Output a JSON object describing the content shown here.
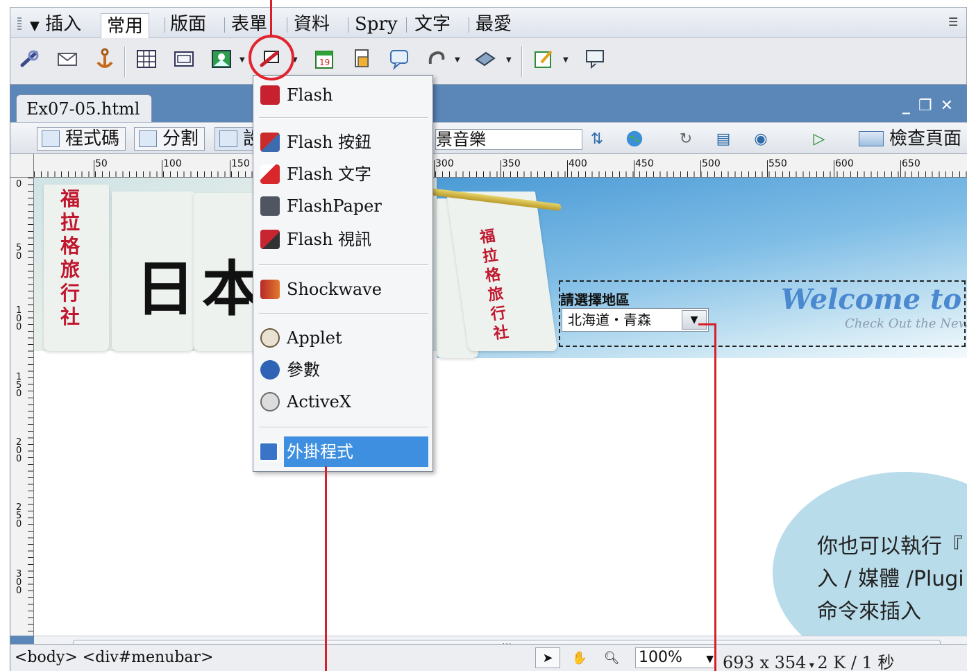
{
  "insert_panel": {
    "menu_label": "插入",
    "tabs": [
      {
        "label": "常用",
        "active": true
      },
      {
        "label": "版面",
        "active": false
      },
      {
        "label": "表單",
        "active": false
      },
      {
        "label": "資料",
        "active": false
      },
      {
        "label": "Spry",
        "active": false
      },
      {
        "label": "文字",
        "active": false
      },
      {
        "label": "最愛",
        "active": false
      }
    ],
    "icons": [
      "hyperlink-icon",
      "email-link-icon",
      "named-anchor-icon",
      "table-icon",
      "layer-icon",
      "image-icon",
      "media-icon",
      "date-icon",
      "server-side-include-icon",
      "comment-icon",
      "head-icon",
      "script-icon",
      "templates-icon",
      "tag-chooser-icon"
    ]
  },
  "document": {
    "file_tab": "Ex07-05.html",
    "view_buttons": {
      "code": "程式碼",
      "split": "分割",
      "design": "設"
    },
    "title_value": "景音樂",
    "check_page": "檢查頁面"
  },
  "ruler": {
    "h_labels": [
      "50",
      "100",
      "150",
      "300",
      "350",
      "400",
      "450",
      "500",
      "550",
      "600",
      "650"
    ],
    "v_labels": [
      "0",
      "50",
      "100",
      "150",
      "200",
      "250",
      "300"
    ]
  },
  "page": {
    "banner_big_text": "日本",
    "banner_side_text_left": "福拉格旅行社",
    "banner_side_text_right": "福拉格旅行社",
    "region_label": "請選擇地區",
    "region_selected": "北海道・青森",
    "welcome": "Welcome to Ja",
    "welcome_sub": "Check Out the New",
    "callout": "你也可以執行『\n入 / 媒體 /Plugi\n命令來插入"
  },
  "status_bar": {
    "tag_selector": "<body> <div#menubar>",
    "zoom": "100%",
    "window_size": "693 x 354",
    "file_stats": "2 K / 1 秒"
  },
  "media_menu": {
    "items": [
      {
        "label": "Flash",
        "icon": "flash-icon",
        "color": "#c7212f"
      },
      {
        "label": "Flash 按鈕",
        "icon": "flash-button-icon",
        "color": "#cc2b2b"
      },
      {
        "label": "Flash 文字",
        "icon": "flash-text-icon",
        "color": "#d8282c"
      },
      {
        "label": "FlashPaper",
        "icon": "flashpaper-icon",
        "color": "#4f5561"
      },
      {
        "label": "Flash 視訊",
        "icon": "flash-video-icon",
        "color": "#c82530"
      },
      {
        "label": "Shockwave",
        "icon": "shockwave-icon",
        "color": "#b7282a"
      },
      {
        "label": "Applet",
        "icon": "applet-icon",
        "color": "#6b5a3e"
      },
      {
        "label": "參數",
        "icon": "parameters-icon",
        "color": "#2f63b6"
      },
      {
        "label": "ActiveX",
        "icon": "activex-icon",
        "color": "#6c6c6c"
      },
      {
        "label": "外掛程式",
        "icon": "plugin-icon",
        "color": "#3a74c8",
        "selected": true
      }
    ]
  },
  "colors": {
    "annotation_red": "#e3232d",
    "menu_selection": "#3e8fe0"
  }
}
